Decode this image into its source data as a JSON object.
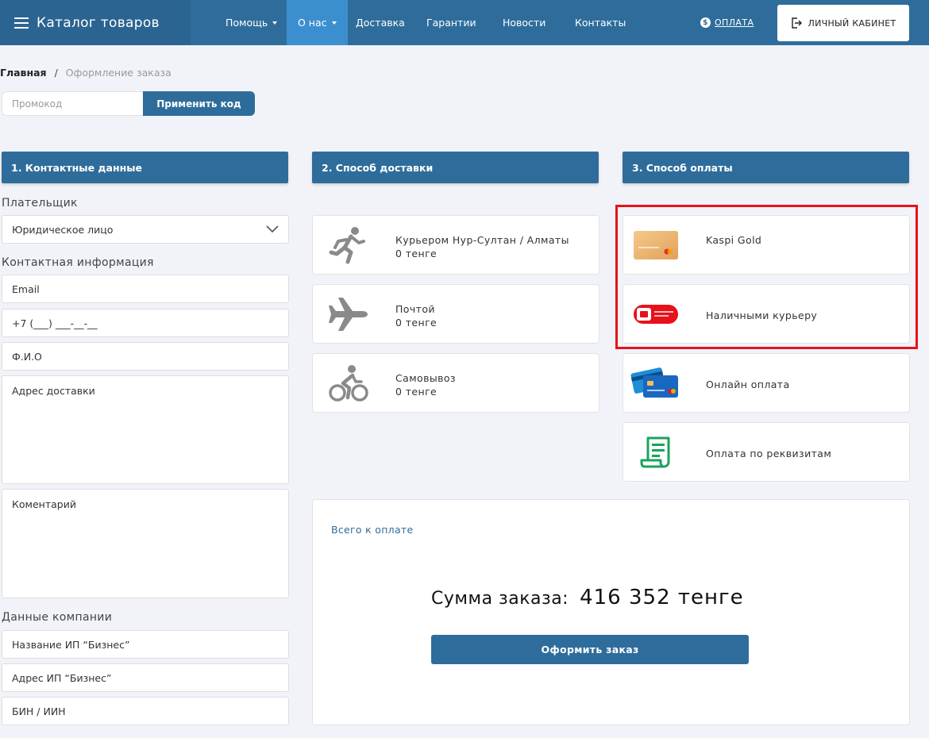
{
  "navbar": {
    "brand": "Каталог товаров",
    "items": [
      {
        "label": "Помощь",
        "dropdown": true
      },
      {
        "label": "О нас",
        "dropdown": true,
        "active": true
      },
      {
        "label": "Доставка"
      },
      {
        "label": "Гарантии"
      },
      {
        "label": "Новости"
      },
      {
        "label": "Контакты"
      }
    ],
    "payment_link": "ОПЛАТА",
    "payment_icon": "$",
    "cabinet_button": "ЛИЧНЫЙ КАБИНЕТ"
  },
  "breadcrumb": {
    "home": "Главная",
    "separator": "/",
    "current": "Оформление заказа"
  },
  "promo": {
    "placeholder": "Промокод",
    "button": "Применить код"
  },
  "contact": {
    "header": "1. Контактные данные",
    "payer_label": "Плательщик",
    "payer_value": "Юридическое лицо",
    "info_label": "Контактная информация",
    "email_placeholder": "Email",
    "phone_placeholder": "+7 (___) ___-__-__",
    "name_placeholder": "Ф.И.О",
    "address_placeholder": "Адрес доставки",
    "comment_placeholder": "Коментарий",
    "company_label": "Данные компании",
    "company_name_placeholder": "Название ИП “Бизнес”",
    "company_address_placeholder": "Адрес ИП “Бизнес”",
    "bin_placeholder": "БИН / ИИН"
  },
  "delivery": {
    "header": "2. Способ доставки",
    "options": [
      {
        "title": "Курьером Нур-Султан / Алматы",
        "price": "0 тенге",
        "icon": "running-courier-icon"
      },
      {
        "title": "Почтой",
        "price": "0 тенге",
        "icon": "airplane-icon"
      },
      {
        "title": "Самовывоз",
        "price": "0 тенге",
        "icon": "bicycle-icon"
      }
    ]
  },
  "payment": {
    "header": "3. Способ оплаты",
    "options": [
      {
        "title": "Kaspi Gold",
        "icon": "kaspi-gold-card-icon"
      },
      {
        "title": "Наличными курьеру",
        "icon": "cash-courier-icon"
      },
      {
        "title": "Онлайн оплата",
        "icon": "bank-cards-icon"
      },
      {
        "title": "Оплата по реквизитам",
        "icon": "invoice-icon"
      }
    ],
    "highlight_color": "#e8101a"
  },
  "summary": {
    "label": "Всего к оплате",
    "sum_label": "Сумма заказа:",
    "sum_value": "416 352 тенге",
    "order_button": "Оформить заказ"
  },
  "colors": {
    "primary": "#2e6d9b",
    "active_nav": "#3c8fcf",
    "background": "#f2f3f8"
  }
}
